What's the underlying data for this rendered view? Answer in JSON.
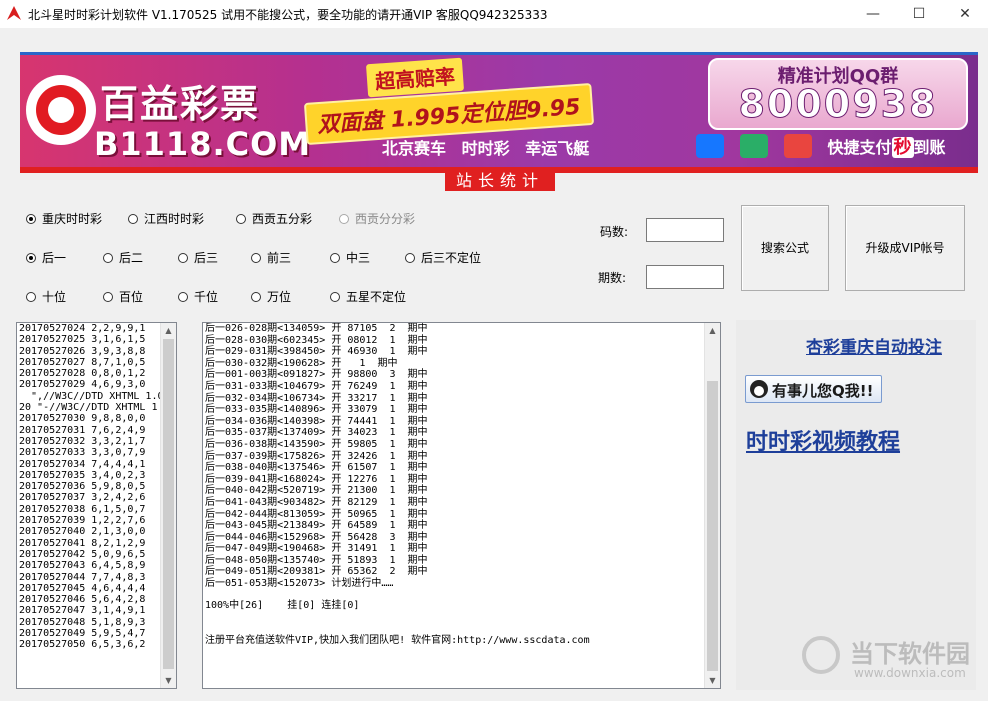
{
  "window": {
    "title": "北斗星时时彩计划软件    V1.170525        试用不能搜公式，要全功能的请开通VIP   客服QQ942325333",
    "controls": [
      "—",
      "☐",
      "✕"
    ]
  },
  "banner": {
    "brand_name": "百益彩票",
    "brand_url": "B1118.COM",
    "promo_headline": "超高赔率",
    "promo_odds": "双面盘 1.995定位胆9.95",
    "games": [
      "北京赛车",
      "时时彩",
      "幸运飞艇"
    ],
    "qq_group_label": "精准计划QQ群",
    "qq_group_number": "8000938",
    "payment_text": "快捷支付",
    "payment_emph": "秒",
    "payment_tail": "到账",
    "colors": {
      "red": "#e02020",
      "purple": "#9b3aa8",
      "gold": "#ffd32a"
    }
  },
  "stats_label": "站长统计",
  "lottery_options": [
    {
      "label": "重庆时时彩",
      "selected": true,
      "enabled": true
    },
    {
      "label": "江西时时彩",
      "selected": false,
      "enabled": true
    },
    {
      "label": "西贡五分彩",
      "selected": false,
      "enabled": true
    },
    {
      "label": "西贡分分彩",
      "selected": false,
      "enabled": false
    }
  ],
  "position_options": [
    {
      "label": "后一",
      "selected": true
    },
    {
      "label": "后二",
      "selected": false
    },
    {
      "label": "后三",
      "selected": false
    },
    {
      "label": "前三",
      "selected": false
    },
    {
      "label": "中三",
      "selected": false
    },
    {
      "label": "后三不定位",
      "selected": false
    }
  ],
  "digit_options": [
    {
      "label": "十位",
      "selected": false
    },
    {
      "label": "百位",
      "selected": false
    },
    {
      "label": "千位",
      "selected": false
    },
    {
      "label": "万位",
      "selected": false
    },
    {
      "label": "五星不定位",
      "selected": false
    }
  ],
  "fields": {
    "code_count_label": "码数:",
    "code_count_value": "",
    "period_count_label": "期数:",
    "period_count_value": ""
  },
  "buttons": {
    "search_formula": "搜索公式",
    "upgrade_vip": "升级成VIP帐号"
  },
  "history": [
    "20170527024 2,2,9,9,1",
    "20170527025 3,1,6,1,5",
    "20170527026 3,9,3,8,8",
    "20170527027 8,7,1,0,5",
    "20170527028 0,8,0,1,2",
    "20170527029 4,6,9,3,0",
    "",
    "  \",//W3C//DTD XHTML 1.0",
    "20 \"-//W3C//DTD XHTML 1",
    "20170527030 9,8,8,0,0",
    "20170527031 7,6,2,4,9",
    "20170527032 3,3,2,1,7",
    "20170527033 3,3,0,7,9",
    "20170527034 7,4,4,4,1",
    "20170527035 3,4,0,2,3",
    "20170527036 5,9,8,0,5",
    "20170527037 3,2,4,2,6",
    "20170527038 6,1,5,0,7",
    "20170527039 1,2,2,7,6",
    "20170527040 2,1,3,0,0",
    "20170527041 8,2,1,2,9",
    "20170527042 5,0,9,6,5",
    "20170527043 6,4,5,8,9",
    "20170527044 7,7,4,8,3",
    "20170527045 4,6,4,4,4",
    "20170527046 5,6,4,2,8",
    "20170527047 3,1,4,9,1",
    "20170527048 5,1,8,9,3",
    "20170527049 5,9,5,4,7",
    "20170527050 6,5,3,6,2"
  ],
  "plan_log": [
    "后一026-028期<134059> 开 87105  2  期中",
    "后一028-030期<602345> 开 08012  1  期中",
    "后一029-031期<398450> 开 46930  1  期中",
    "后一030-032期<190628> 开   1  期中",
    "后一001-003期<091827> 开 98800  3  期中",
    "后一031-033期<104679> 开 76249  1  期中",
    "后一032-034期<106734> 开 33217  1  期中",
    "后一033-035期<140896> 开 33079  1  期中",
    "后一034-036期<140398> 开 74441  1  期中",
    "后一035-037期<137409> 开 34023  1  期中",
    "后一036-038期<143590> 开 59805  1  期中",
    "后一037-039期<175826> 开 32426  1  期中",
    "后一038-040期<137546> 开 61507  1  期中",
    "后一039-041期<168024> 开 12276  1  期中",
    "后一040-042期<520719> 开 21300  1  期中",
    "后一041-043期<903482> 开 82129  1  期中",
    "后一042-044期<813059> 开 50965  1  期中",
    "后一043-045期<213849> 开 64589  1  期中",
    "后一044-046期<152968> 开 56428  3  期中",
    "后一047-049期<190468> 开 31491  1  期中",
    "后一048-050期<135740> 开 51893  1  期中",
    "后一049-051期<209381> 开 65362  2  期中",
    "后一051-053期<152073> 计划进行中……"
  ],
  "plan_summary": "100%中[26]    挂[0] 连挂[0]",
  "plan_footer": "注册平台充值送软件VIP,快加入我们团队吧! 软件官网:http://www.sscdata.com",
  "right_panel": {
    "auto_bet_link": "杏彩重庆自动投注",
    "qq_button": "有事儿您Q我!!",
    "video_link": "时时彩视频教程"
  },
  "watermark": {
    "name": "当下软件园",
    "url": "www.downxia.com"
  }
}
